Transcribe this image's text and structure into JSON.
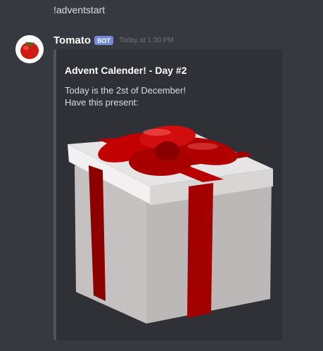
{
  "previous_message": {
    "text": "!adventstart"
  },
  "message": {
    "author": "Tomato",
    "badge": "BOT",
    "timestamp": "Today at 1:30 PM",
    "avatar_icon": "tomato-icon"
  },
  "embed": {
    "title": "Advent Calender! - Day #2",
    "description": "Today is the 2st of December!\nHave this present:",
    "image_icon": "gift-box-icon",
    "accent_color": "#4f545c"
  },
  "colors": {
    "background": "#36393f",
    "embed_background": "#2f3136",
    "bot_badge": "#7289da",
    "ribbon": "#b10000"
  }
}
